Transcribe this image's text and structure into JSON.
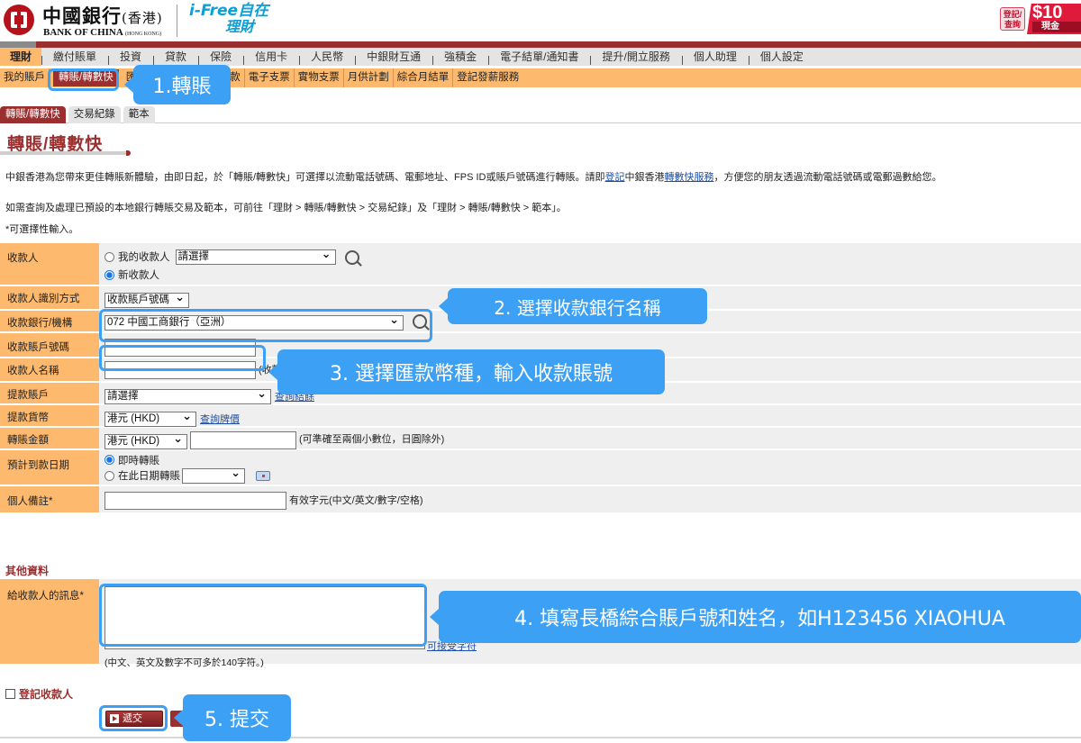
{
  "header": {
    "bank_name_cn": "中國銀行",
    "bank_region_cn": "(香港)",
    "bank_name_en": "BANK OF CHINA",
    "bank_region_en": "(HONG KONG)",
    "ifree_line1": "i-Free自在",
    "ifree_line2": "理財",
    "promo_tag": "登記/查詢",
    "promo_amount": "$10",
    "promo_sub": "現金"
  },
  "main_nav": [
    {
      "label": "理財",
      "active": true
    },
    {
      "label": "繳付賬單"
    },
    {
      "label": "投資"
    },
    {
      "label": "貸款"
    },
    {
      "label": "保險"
    },
    {
      "label": "信用卡"
    },
    {
      "label": "人民幣"
    },
    {
      "label": "中銀財互通"
    },
    {
      "label": "強積金"
    },
    {
      "label": "電子結單/通知書"
    },
    {
      "label": "提升/開立服務"
    },
    {
      "label": "個人助理"
    },
    {
      "label": "個人設定"
    }
  ],
  "sub_nav": [
    {
      "label": "我的賬戶"
    },
    {
      "label": "轉賬/轉數快",
      "active": true
    },
    {
      "label": "匯款"
    },
    {
      "label": "存款"
    },
    {
      "label": "電子支票"
    },
    {
      "label": "實物支票"
    },
    {
      "label": "月供計劃"
    },
    {
      "label": "綜合月結單"
    },
    {
      "label": "登記發薪服務"
    }
  ],
  "tabs": [
    {
      "label": "轉賬/轉數快",
      "active": true
    },
    {
      "label": "交易紀錄"
    },
    {
      "label": "範本"
    }
  ],
  "page_title": "轉賬/轉數快",
  "intro": {
    "p1_before": "中銀香港為您帶來更佳轉賬新體驗，由即日起，於「轉賬/轉數快」可選擇以流動電話號碼、電郵地址、FPS ID或賬戶號碼進行轉賬。請即",
    "p1_link1": "登記",
    "p1_middle": "中銀香港",
    "p1_link2": "轉數快服務",
    "p1_after": "，方便您的朋友透過流動電話號碼或電郵過數給您。",
    "p2": "如需查詢及處理已預設的本地銀行轉賬交易及範本，可前往「理財 > 轉賬/轉數快 > 交易紀錄」及「理財 > 轉賬/轉數快 > 範本」。",
    "p3": "*可選擇性輸入。"
  },
  "form": {
    "payee": {
      "label": "收款人",
      "option_my": "我的收款人",
      "my_select": "請選擇",
      "option_new": "新收款人",
      "selected": "新收款人"
    },
    "identify": {
      "label": "收款人識別方式",
      "value": "收款賬戶號碼"
    },
    "bank": {
      "label": "收款銀行/機構",
      "value": "072 中國工商銀行（亞洲）"
    },
    "account_no": {
      "label": "收款賬戶號碼",
      "value": ""
    },
    "payee_name": {
      "label": "收款人名稱",
      "value": "",
      "hint": "(收款"
    },
    "debit_account": {
      "label": "提款賬戶",
      "value": "請選擇",
      "link": "查詢結餘"
    },
    "debit_currency": {
      "label": "提款貨幣",
      "value": "港元 (HKD)",
      "link": "查詢牌價"
    },
    "amount": {
      "label": "轉賬金額",
      "currency": "港元 (HKD)",
      "value": "",
      "hint": "(可準確至兩個小數位，日圓除外)"
    },
    "date": {
      "label": "預計到款日期",
      "option_now": "即時轉賬",
      "option_date": "在此日期轉賬",
      "date_value": "",
      "selected": "即時轉賬"
    },
    "note": {
      "label": "個人備註*",
      "value": "",
      "hint": "有效字元(中文/英文/數字/空格)"
    }
  },
  "other": {
    "section_title": "其他資料",
    "message_label": "給收款人的訊息*",
    "message_value": "",
    "message_link": "可接受字符",
    "message_note": "(中文、英文及數字不可多於140字符。)"
  },
  "register_payee": {
    "label": "登記收款人",
    "checked": false
  },
  "submit_label": "遞交",
  "callouts": {
    "c1": "1.轉賬",
    "c2": "2. 選擇收款銀行名稱",
    "c3": "3. 選擇匯款幣種，輸入收款賬號",
    "c4": "4. 填寫長橋綜合賬戶號和姓名，如H123456 XIAOHUA",
    "c5": "5. 提交"
  }
}
